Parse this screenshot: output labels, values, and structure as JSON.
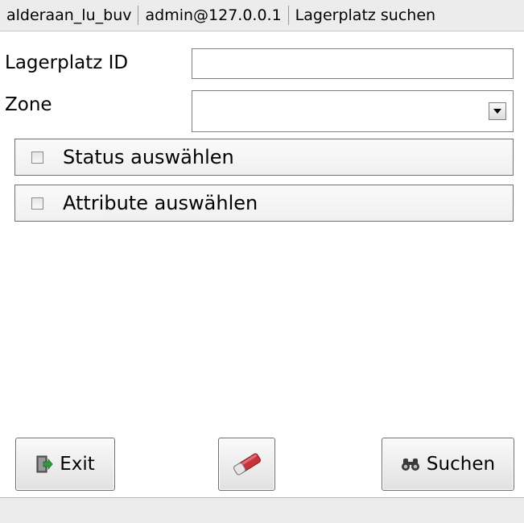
{
  "header": {
    "db": "alderaan_lu_buv",
    "user": "admin@127.0.0.1",
    "screen_title": "Lagerplatz suchen"
  },
  "form": {
    "lagerplatz_id": {
      "label": "Lagerplatz ID",
      "value": ""
    },
    "zone": {
      "label": "Zone",
      "value": ""
    }
  },
  "groups": {
    "status": {
      "label": "Status auswählen",
      "checked": false
    },
    "attribute": {
      "label": "Attribute auswählen",
      "checked": false
    }
  },
  "buttons": {
    "exit": {
      "label": "Exit",
      "icon": "exit-door-icon"
    },
    "clear": {
      "label": "",
      "icon": "eraser-icon"
    },
    "search": {
      "label": "Suchen",
      "icon": "binoculars-icon"
    }
  },
  "status_bar": {
    "text": ""
  },
  "colors": {
    "header_bg": "#ececec",
    "border": "#7f7f7f",
    "button_top": "#fafafa",
    "button_bottom": "#e1e1e1",
    "eraser_red": "#c8323a",
    "exit_green": "#2f9b3a"
  }
}
